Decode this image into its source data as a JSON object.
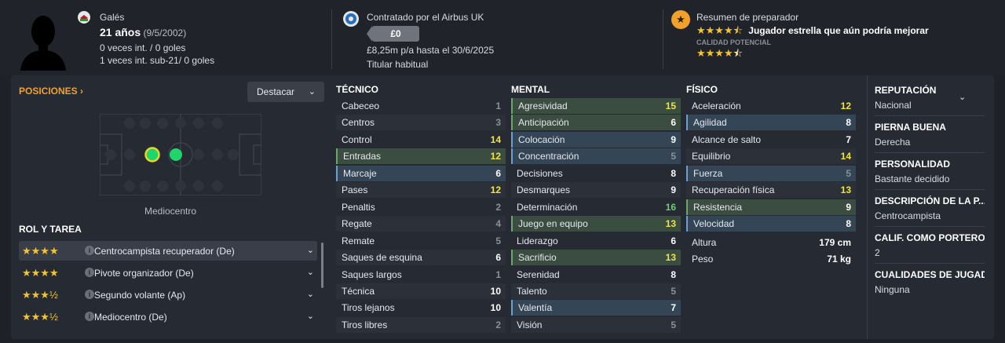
{
  "player": {
    "nationality": "Galés",
    "age": "21 años",
    "birthdate": "(9/5/2002)",
    "caps": "0 veces int. / 0 goles",
    "u21_caps": "1 veces int. sub-21/ 0 goles"
  },
  "contract": {
    "club": "Contratado por el Airbus UK",
    "value": "£0",
    "wage": "£8,25m p/a hasta el 30/6/2025",
    "status": "Titular habitual"
  },
  "coach": {
    "title": "Resumen de preparador",
    "current_stars": 4.5,
    "summary": "Jugador estrella que aún podría mejorar",
    "potential_label": "CALIDAD POTENCIAL",
    "potential_stars": 4.5
  },
  "positions": {
    "title": "POSICIONES",
    "highlight_button": "Destacar",
    "position_label": "Mediocentro"
  },
  "roles": {
    "title": "ROL Y TAREA",
    "items": [
      {
        "stars": "★★★★",
        "name": "Centrocampista recuperador (De)",
        "selected": true
      },
      {
        "stars": "★★★★",
        "name": "Pivote organizador (De)",
        "selected": false
      },
      {
        "stars": "★★★½",
        "name": "Segundo volante (Ap)",
        "selected": false
      },
      {
        "stars": "★★★½",
        "name": "Mediocentro (De)",
        "selected": false
      }
    ]
  },
  "attributes": {
    "tecnico": {
      "title": "TÉCNICO",
      "rows": [
        {
          "name": "Cabeceo",
          "value": "1",
          "hl": "",
          "color": "gray"
        },
        {
          "name": "Centros",
          "value": "3",
          "hl": "",
          "color": "gray"
        },
        {
          "name": "Control",
          "value": "14",
          "hl": "",
          "color": "yellow"
        },
        {
          "name": "Entradas",
          "value": "12",
          "hl": "green",
          "color": "yellow"
        },
        {
          "name": "Marcaje",
          "value": "6",
          "hl": "blue",
          "color": "white"
        },
        {
          "name": "Pases",
          "value": "12",
          "hl": "",
          "color": "yellow"
        },
        {
          "name": "Penaltis",
          "value": "2",
          "hl": "",
          "color": "gray"
        },
        {
          "name": "Regate",
          "value": "4",
          "hl": "",
          "color": "gray"
        },
        {
          "name": "Remate",
          "value": "5",
          "hl": "",
          "color": "gray"
        },
        {
          "name": "Saques de esquina",
          "value": "6",
          "hl": "",
          "color": "white"
        },
        {
          "name": "Saques largos",
          "value": "1",
          "hl": "",
          "color": "gray"
        },
        {
          "name": "Técnica",
          "value": "10",
          "hl": "",
          "color": "white"
        },
        {
          "name": "Tiros lejanos",
          "value": "10",
          "hl": "",
          "color": "white"
        },
        {
          "name": "Tiros libres",
          "value": "2",
          "hl": "",
          "color": "gray"
        }
      ]
    },
    "mental": {
      "title": "MENTAL",
      "rows": [
        {
          "name": "Agresividad",
          "value": "15",
          "hl": "green",
          "color": "yellow"
        },
        {
          "name": "Anticipación",
          "value": "6",
          "hl": "green",
          "color": "white"
        },
        {
          "name": "Colocación",
          "value": "9",
          "hl": "blue",
          "color": "white"
        },
        {
          "name": "Concentración",
          "value": "5",
          "hl": "blue",
          "color": "gray"
        },
        {
          "name": "Decisiones",
          "value": "8",
          "hl": "",
          "color": "white"
        },
        {
          "name": "Desmarques",
          "value": "9",
          "hl": "",
          "color": "white"
        },
        {
          "name": "Determinación",
          "value": "16",
          "hl": "",
          "color": "green"
        },
        {
          "name": "Juego en equipo",
          "value": "13",
          "hl": "green",
          "color": "yellow"
        },
        {
          "name": "Liderazgo",
          "value": "6",
          "hl": "",
          "color": "white"
        },
        {
          "name": "Sacrificio",
          "value": "13",
          "hl": "green",
          "color": "yellow"
        },
        {
          "name": "Serenidad",
          "value": "8",
          "hl": "",
          "color": "white"
        },
        {
          "name": "Talento",
          "value": "5",
          "hl": "",
          "color": "gray"
        },
        {
          "name": "Valentía",
          "value": "7",
          "hl": "blue",
          "color": "white"
        },
        {
          "name": "Visión",
          "value": "5",
          "hl": "",
          "color": "gray"
        }
      ]
    },
    "fisico": {
      "title": "FÍSICO",
      "rows": [
        {
          "name": "Aceleración",
          "value": "12",
          "hl": "",
          "color": "yellow"
        },
        {
          "name": "Agilidad",
          "value": "8",
          "hl": "blue",
          "color": "white"
        },
        {
          "name": "Alcance de salto",
          "value": "7",
          "hl": "",
          "color": "white"
        },
        {
          "name": "Equilibrio",
          "value": "14",
          "hl": "",
          "color": "yellow"
        },
        {
          "name": "Fuerza",
          "value": "5",
          "hl": "blue",
          "color": "gray"
        },
        {
          "name": "Recuperación física",
          "value": "13",
          "hl": "",
          "color": "yellow"
        },
        {
          "name": "Resistencia",
          "value": "9",
          "hl": "green",
          "color": "white"
        },
        {
          "name": "Velocidad",
          "value": "8",
          "hl": "blue",
          "color": "white"
        }
      ],
      "height_label": "Altura",
      "height": "179 cm",
      "weight_label": "Peso",
      "weight": "71 kg"
    }
  },
  "info": {
    "reputation_label": "REPUTACIÓN",
    "reputation": "Nacional",
    "foot_label": "PIERNA BUENA",
    "foot": "Derecha",
    "personality_label": "PERSONALIDAD",
    "personality": "Bastante decidido",
    "description_label": "DESCRIPCIÓN DE LA P...",
    "description": "Centrocampista",
    "gk_label": "CALIF. COMO PORTERO",
    "gk": "2",
    "qualities_label": "CUALIDADES DE JUGADO",
    "qualities": "Ninguna"
  },
  "colors": {
    "accent": "#f0a12c",
    "star": "#f4c430",
    "green_highlight": "#3b4c40",
    "blue_highlight": "#344656",
    "good_value": "#f0e442",
    "excellent_value": "#68d26a"
  }
}
